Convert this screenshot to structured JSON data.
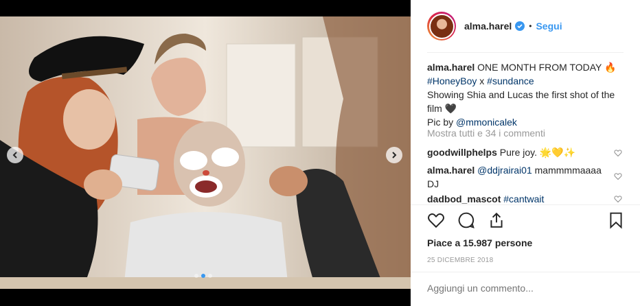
{
  "post": {
    "username": "alma.harel",
    "follow_label": "Segui",
    "header_separator": "•",
    "caption": {
      "username": "alma.harel",
      "line1": "ONE MONTH FROM TODAY 🔥",
      "tag1": "#HoneyBoy",
      "x": " x ",
      "tag2": "#sundance",
      "line3": "Showing Shia and Lucas the first shot of the film 🖤",
      "picby": "Pic by ",
      "mention": "@mmonicalek"
    },
    "view_all_comments": "Mostra tutti e 34 i commenti",
    "comments": [
      {
        "username": "goodwillphelps",
        "text": "Pure joy. 🌟💛✨",
        "mention": ""
      },
      {
        "username": "alma.harel",
        "mention": "@ddjrairai01",
        "text": " mammmmaaaa DJ"
      },
      {
        "username": "dadbod_mascot",
        "mention": "#cantwait",
        "text": ""
      }
    ],
    "likes": "Piace a 15.987 persone",
    "date": "25 DICEMBRE 2018",
    "add_comment_placeholder": "Aggiungi un commento...",
    "carousel": {
      "total": 3,
      "active_index": 1
    },
    "colors": {
      "accent": "#3897f0",
      "link": "#003569",
      "muted": "#999999"
    },
    "icons": [
      "chevron-left-icon",
      "chevron-right-icon",
      "verified-icon",
      "heart-icon",
      "comment-icon",
      "share-icon",
      "bookmark-icon"
    ]
  }
}
